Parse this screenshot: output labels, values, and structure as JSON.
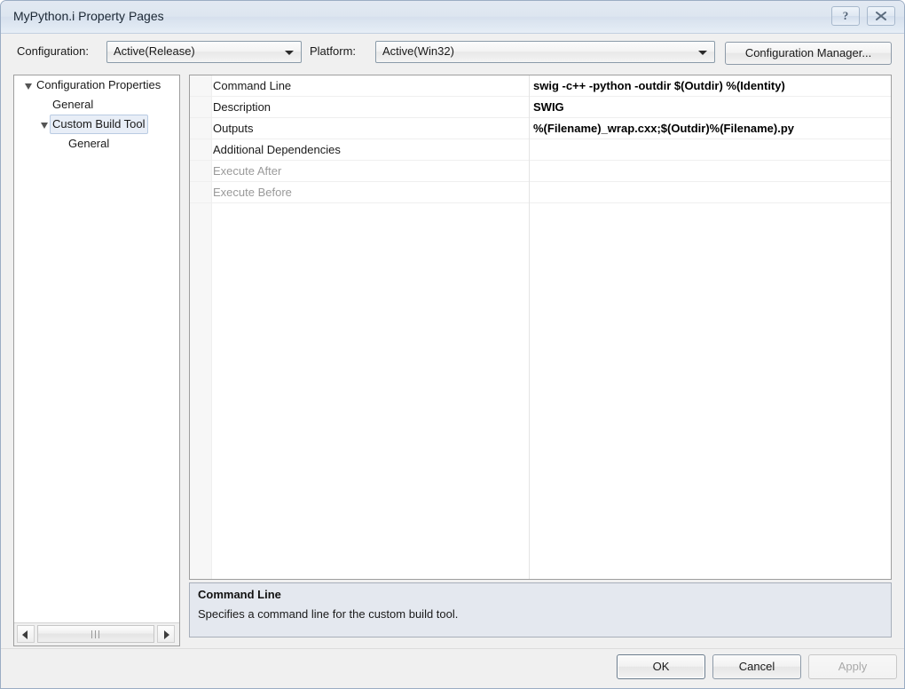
{
  "window": {
    "title": "MyPython.i Property Pages",
    "help_button_glyph": "?",
    "close_button_label": "Close"
  },
  "toolbar": {
    "configuration_label": "Configuration:",
    "configuration_value": "Active(Release)",
    "platform_label": "Platform:",
    "platform_value": "Active(Win32)",
    "configuration_manager_label": "Configuration Manager..."
  },
  "tree": {
    "nodes": [
      {
        "label": "Configuration Properties",
        "depth": 0,
        "expanded": true,
        "selected": false
      },
      {
        "label": "General",
        "depth": 1,
        "expanded": false,
        "selected": false
      },
      {
        "label": "Custom Build Tool",
        "depth": 1,
        "expanded": true,
        "selected": true
      },
      {
        "label": "General",
        "depth": 2,
        "expanded": false,
        "selected": false
      }
    ]
  },
  "grid": {
    "rows": [
      {
        "name": "Command Line",
        "value": "swig -c++ -python -outdir $(Outdir) %(Identity)",
        "disabled": false
      },
      {
        "name": "Description",
        "value": "SWIG",
        "disabled": false
      },
      {
        "name": "Outputs",
        "value": "%(Filename)_wrap.cxx;$(Outdir)%(Filename).py",
        "disabled": false
      },
      {
        "name": "Additional Dependencies",
        "value": "",
        "disabled": false
      },
      {
        "name": "Execute After",
        "value": "",
        "disabled": true
      },
      {
        "name": "Execute Before",
        "value": "",
        "disabled": true
      }
    ]
  },
  "description": {
    "title": "Command Line",
    "text": "Specifies a command line for the custom build tool."
  },
  "footer": {
    "ok_label": "OK",
    "cancel_label": "Cancel",
    "apply_label": "Apply"
  },
  "colors": {
    "title_bar": "#dde6f0",
    "dialog_background": "#f0f0f0",
    "description_panel": "#e4e8ef",
    "selection": "#e8eef7"
  }
}
